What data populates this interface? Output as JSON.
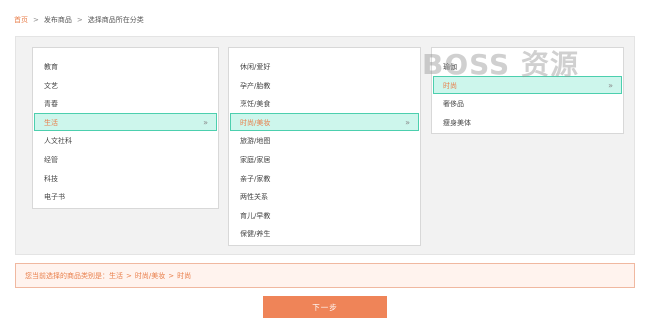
{
  "breadcrumb": {
    "items": [
      "首页",
      "发布商品",
      "选择商品所在分类"
    ],
    "separator": ">"
  },
  "columns": [
    {
      "items": [
        "教育",
        "文艺",
        "青春",
        "生活",
        "人文社科",
        "经管",
        "科技",
        "电子书"
      ],
      "selected_index": 3
    },
    {
      "items": [
        "休闲/爱好",
        "孕产/胎教",
        "烹饪/美食",
        "时尚/美妆",
        "旅游/地图",
        "家庭/家居",
        "亲子/家教",
        "两性关系",
        "育儿/早教",
        "保健/养生"
      ],
      "selected_index": 3
    },
    {
      "items": [
        "瑜伽",
        "时尚",
        "奢侈品",
        "瘦身美体"
      ],
      "selected_index": 1
    }
  ],
  "chevron_glyph": "»",
  "watermark": "BOSS 资源",
  "selection": {
    "label": "您当前选择的商品类别是：",
    "path": [
      "生活",
      "时尚/美妆",
      "时尚"
    ],
    "separator": ">"
  },
  "next_button_label": "下一步",
  "colors": {
    "accent_orange": "#e97f4b",
    "button_orange": "#ef8458",
    "selected_bg": "#cdf6ec",
    "selected_border": "#4ccfae"
  }
}
